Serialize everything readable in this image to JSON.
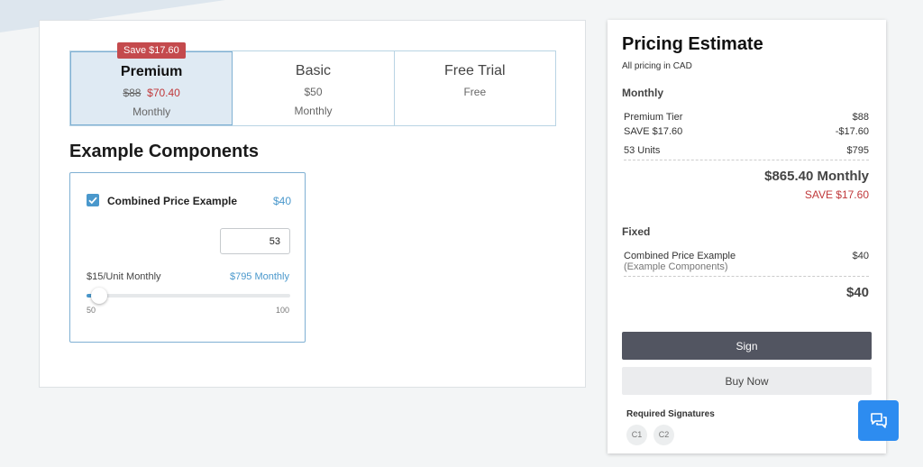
{
  "tiers": [
    {
      "name": "Premium",
      "price_original": "$88",
      "price_discounted": "$70.40",
      "period": "Monthly",
      "badge": "Save $17.60"
    },
    {
      "name": "Basic",
      "price": "$50",
      "period": "Monthly"
    },
    {
      "name": "Free Trial",
      "price": "Free"
    }
  ],
  "components": {
    "title": "Example Components",
    "item": {
      "name": "Combined Price Example",
      "price": "$40",
      "quantity": "53",
      "unit_label": "$15/Unit Monthly",
      "unit_total": "$795 Monthly",
      "slider": {
        "min": "50",
        "max": "100",
        "value": 53
      }
    }
  },
  "estimate": {
    "title": "Pricing Estimate",
    "subtitle": "All pricing in CAD",
    "monthly_label": "Monthly",
    "monthly_rows": [
      {
        "label": "Premium Tier",
        "value": "$88"
      },
      {
        "label": "SAVE $17.60",
        "value": "-$17.60"
      },
      {
        "label": "53 Units",
        "value": "$795"
      }
    ],
    "monthly_total": "$865.40 Monthly",
    "monthly_save": "SAVE $17.60",
    "fixed_label": "Fixed",
    "fixed_row": {
      "label": "Combined Price Example",
      "sublabel": "(Example Components)",
      "value": "$40"
    },
    "fixed_total": "$40",
    "sign_label": "Sign",
    "buy_label": "Buy Now",
    "required_signatures_label": "Required Signatures",
    "signatures": [
      "C1",
      "C2"
    ]
  },
  "colors": {
    "accent": "#4a98cc",
    "save": "#c0393b",
    "sign_button": "#525561",
    "chat_button": "#2d8cf0"
  }
}
